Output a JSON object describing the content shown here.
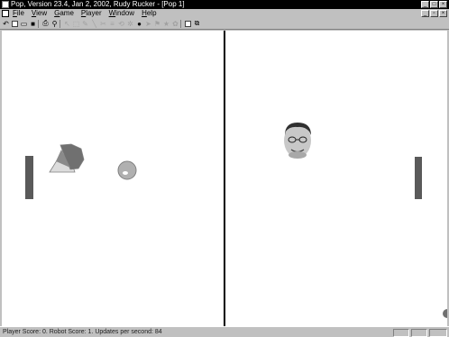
{
  "window": {
    "title": "Pop, Version 23.4, Jan 2, 2002, Rudy Rucker - [Pop 1]"
  },
  "menu": {
    "items": [
      "File",
      "View",
      "Game",
      "Player",
      "Window",
      "Help"
    ]
  },
  "toolbar": {
    "icons": [
      "new-icon",
      "open-icon",
      "save-icon",
      "print-icon",
      "zoom-icon",
      "pointer-icon",
      "select-icon",
      "pencil-icon",
      "line-icon",
      "edit-icon",
      "move-icon",
      "rotate-icon",
      "dot-icon",
      "arrow-icon",
      "flag-icon",
      "star-icon",
      "pattern-icon",
      "window-icon",
      "windows-icon"
    ]
  },
  "status": {
    "text": "Player Score: 0.  Robot Score: 1.  Updates per second: 84"
  },
  "colors": {
    "paddle": "#5a5a5a",
    "pane_bg": "#ffffff",
    "chrome": "#c0c0c0",
    "shape_light": "#dcdcdc",
    "shape_dark": "#707070"
  }
}
